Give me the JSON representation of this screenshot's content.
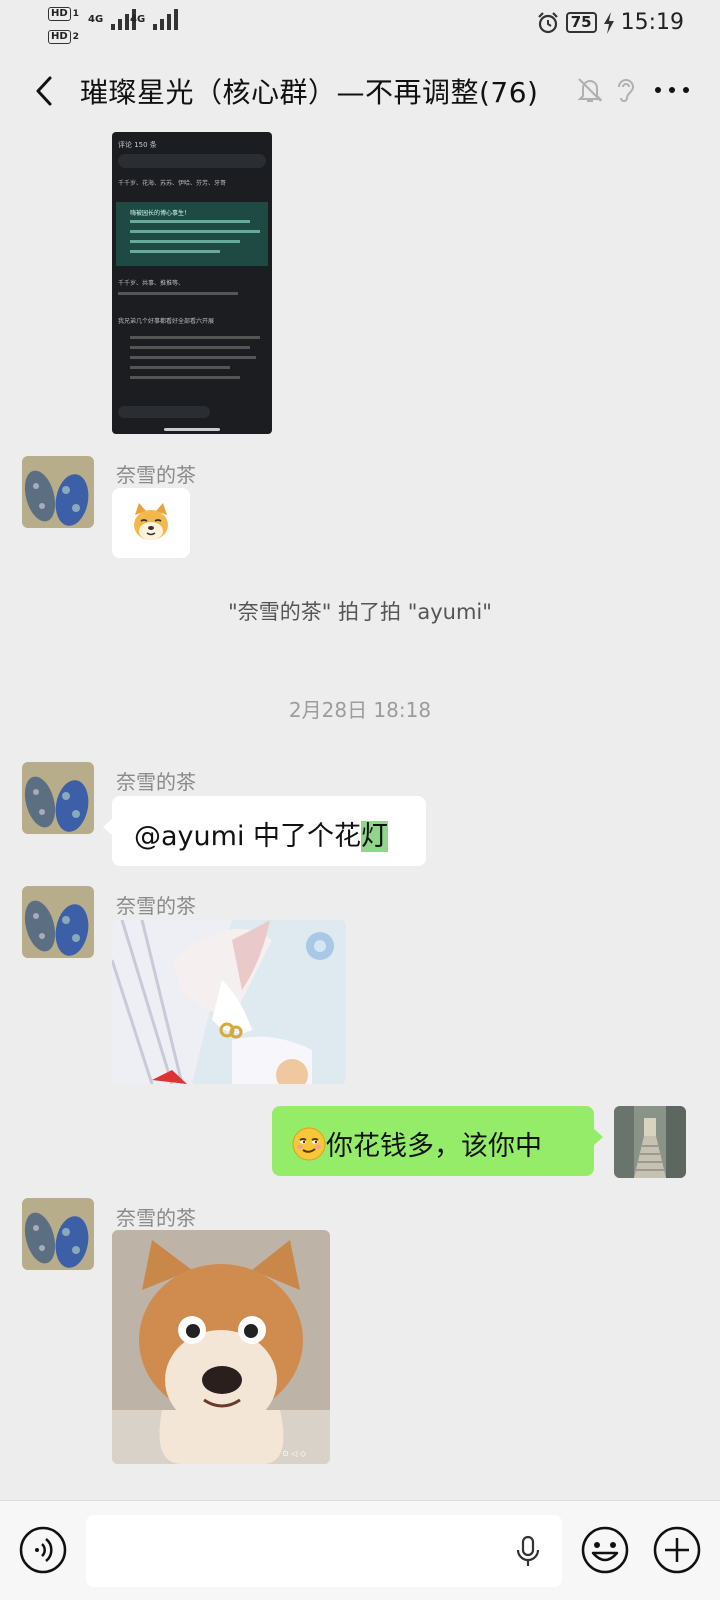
{
  "status_bar": {
    "hd1": "HD",
    "hd2": "HD",
    "sim1": "1",
    "sim2": "2",
    "signal1": "4G",
    "signal2": "4G",
    "battery": "75",
    "time": "15:19"
  },
  "nav": {
    "title": "璀璨星光（核心群）—不再调整(76)"
  },
  "messages": {
    "m1_sender": "奈雪的茶",
    "system_text": "\"奈雪的茶\" 拍了拍 \"ayumi\"",
    "timestamp": "2月28日 18:18",
    "m2_sender": "奈雪的茶",
    "m2_text_a": "@ayumi  中了个花",
    "m2_text_b": "灯",
    "m3_sender": "奈雪的茶",
    "m4_text": "你花钱多，该你中",
    "m5_sender": "奈雪的茶"
  },
  "screenshot_thumb": {
    "header": "评论 150 条",
    "lines": [
      "千千岁、花海、苏苏、伊哈、芬芳、牙哥",
      "嗨被园长的博心事生！",
      "千千岁、共事、推推等、",
      "我兄弟几个好事都看好全部看六开展"
    ]
  },
  "colors": {
    "background": "#ededed",
    "green_bubble": "#95ec69",
    "white_bubble": "#ffffff"
  },
  "icons": {
    "back": "back-icon",
    "mute": "mute-icon",
    "ear": "ear-icon",
    "more": "more-icon",
    "voice": "voice-icon",
    "mic": "mic-icon",
    "emoji": "emoji-icon",
    "plus": "plus-icon"
  }
}
